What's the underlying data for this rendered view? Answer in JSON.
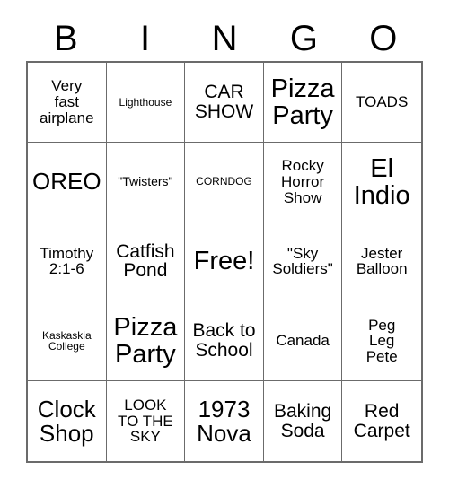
{
  "card": {
    "headers": [
      "B",
      "I",
      "N",
      "G",
      "O"
    ],
    "rows": [
      [
        {
          "text": "Very\nfast\nairplane",
          "size": "md"
        },
        {
          "text": "Lighthouse",
          "size": "xs"
        },
        {
          "text": "CAR\nSHOW",
          "size": "lg"
        },
        {
          "text": "Pizza\nParty",
          "size": "xxl"
        },
        {
          "text": "TOADS",
          "size": "md"
        }
      ],
      [
        {
          "text": "OREO",
          "size": "xl"
        },
        {
          "text": "\"Twisters\"",
          "size": "sm"
        },
        {
          "text": "CORNDOG",
          "size": "xs"
        },
        {
          "text": "Rocky\nHorror\nShow",
          "size": "md"
        },
        {
          "text": "El\nIndio",
          "size": "xxl"
        }
      ],
      [
        {
          "text": "Timothy\n2:1-6",
          "size": "md"
        },
        {
          "text": "Catfish\nPond",
          "size": "lg"
        },
        {
          "text": "Free!",
          "size": "xxl"
        },
        {
          "text": "\"Sky\nSoldiers\"",
          "size": "md"
        },
        {
          "text": "Jester\nBalloon",
          "size": "md"
        }
      ],
      [
        {
          "text": "Kaskaskia\nCollege",
          "size": "xs"
        },
        {
          "text": "Pizza\nParty",
          "size": "xxl"
        },
        {
          "text": "Back to\nSchool",
          "size": "lg"
        },
        {
          "text": "Canada",
          "size": "md"
        },
        {
          "text": "Peg\nLeg\nPete",
          "size": "md"
        }
      ],
      [
        {
          "text": "Clock\nShop",
          "size": "xl"
        },
        {
          "text": "LOOK\nTO THE\nSKY",
          "size": "md"
        },
        {
          "text": "1973\nNova",
          "size": "xl"
        },
        {
          "text": "Baking\nSoda",
          "size": "lg"
        },
        {
          "text": "Red\nCarpet",
          "size": "lg"
        }
      ]
    ],
    "free_space": {
      "row": 2,
      "col": 2,
      "label": "Free!"
    },
    "colors": {
      "background": "#ffffff",
      "text": "#000000",
      "grid_line": "#6b6b6b"
    }
  }
}
